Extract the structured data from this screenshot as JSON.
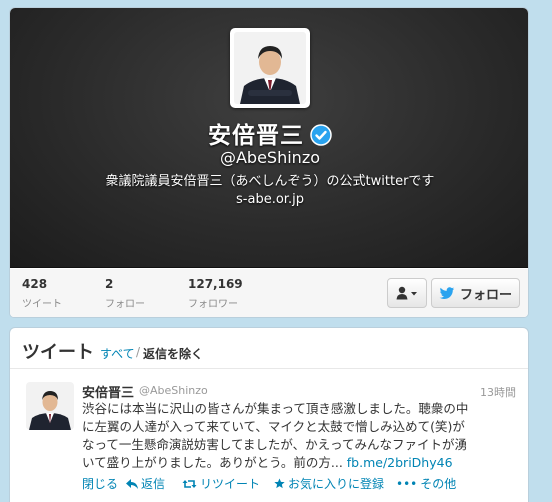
{
  "profile": {
    "name": "安倍晋三",
    "handle": "@AbeShinzo",
    "bio": "衆議院議員安倍晋三（あべしんぞう）の公式twitterです",
    "website": "s-abe.or.jp",
    "verified": true
  },
  "stats": [
    {
      "value": "428",
      "label": "ツイート"
    },
    {
      "value": "2",
      "label": "フォロー"
    },
    {
      "value": "127,169",
      "label": "フォロワー"
    }
  ],
  "actions": {
    "user_menu_icon": "user-dropdown-icon",
    "follow_label": "フォロー"
  },
  "tweets": {
    "title": "ツイート",
    "filter_all": "すべて",
    "filter_sep": "/",
    "filter_no_replies": "返信を除く",
    "items": [
      {
        "name": "安倍晋三",
        "handle": "@AbeShinzo",
        "time": "13時間",
        "text_line1": "渋谷には本当に沢山の皆さんが集まって頂き感激しました。聴衆の中",
        "text_line2": "に左翼の人達が入って来ていて、マイクと太鼓で憎しみ込めて(笑)が",
        "text_line3": "なって一生懸命演説妨害してましたが、かえってみんなファイトが湧",
        "text_line4": "いて盛り上がりました。ありがとう。前の方...",
        "link": "fb.me/2briDhy46",
        "collapse": "閉じる",
        "reply": "返信",
        "retweet": "リツイート",
        "favorite": "お気に入りに登録",
        "more": "その他"
      }
    ]
  },
  "colors": {
    "background": "#c0deed",
    "link": "#0084b4",
    "verified": "#2aa3ef",
    "header": "#2b2b2b"
  }
}
